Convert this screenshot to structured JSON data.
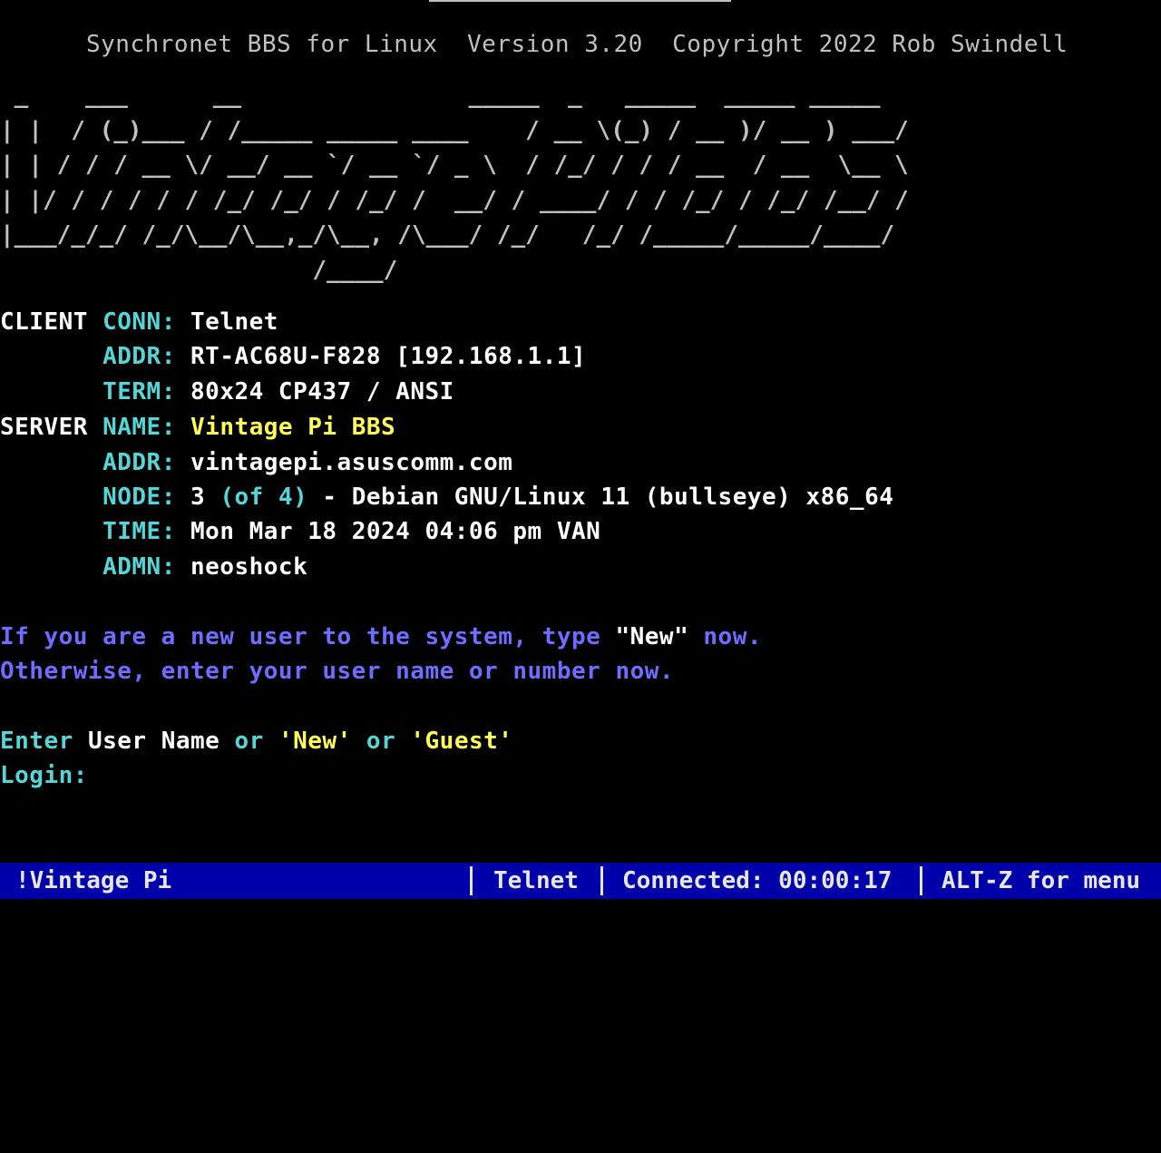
{
  "header": {
    "title": "Synchronet BBS for Linux  Version 3.20  Copyright 2022 Rob Swindell"
  },
  "banner": {
    "art": " _    ___      __                _____  _   _____  _____ _____\n| |  / (_)___ / /_____ _____ ____    / __ \\(_) / __ )/ __ ) ___/\n| | / / / __ \\/ __/ __ `/ __ `/ _ \\  / /_/ / / / __  / __  \\__ \\\n| |/ / / / / / /_/ /_/ / /_/ /  __/ / ____/ / / /_/ / /_/ /__/ /\n|___/_/_/ /_/\\__/\\__,_/\\__, /\\___/ /_/   /_/ /_____/_____/____/\n                      /____/"
  },
  "client": {
    "section": "CLIENT",
    "conn_label": "CONN:",
    "conn": "Telnet",
    "addr_label": "ADDR:",
    "addr": "RT-AC68U-F828 [192.168.1.1]",
    "term_label": "TERM:",
    "term": "80x24 CP437 / ANSI"
  },
  "server": {
    "section": "SERVER",
    "name_label": "NAME:",
    "name": "Vintage Pi BBS",
    "addr_label": "ADDR:",
    "addr": "vintagepi.asuscomm.com",
    "node_label": "NODE:",
    "node_num": "3",
    "node_of": "(of 4)",
    "node_rest": "- Debian GNU/Linux 11 (bullseye) x86_64",
    "time_label": "TIME:",
    "time": "Mon Mar 18 2024 04:06 pm VAN",
    "admn_label": "ADMN:",
    "admn": "neoshock"
  },
  "message": {
    "line1_a": "If you are a new user to the system, type ",
    "line1_new": "\"New\"",
    "line1_b": " now.",
    "line2": "Otherwise, enter your user name or number now."
  },
  "prompt": {
    "enter": "Enter",
    "user_name": "User Name",
    "or1": "or",
    "new": "'New'",
    "or2": "or",
    "guest": "'Guest'",
    "login": "Login:"
  },
  "status_bar": {
    "bbs_name": "!Vintage Pi",
    "protocol": "Telnet",
    "connected": "Connected: 00:00:17",
    "menu_hint": "ALT-Z for menu"
  },
  "colors": {
    "background": "#000000",
    "status_bar_bg": "#0000aa",
    "cyan": "#55d5d5",
    "yellow": "#ffff55",
    "blue_text": "#6d6dff"
  }
}
